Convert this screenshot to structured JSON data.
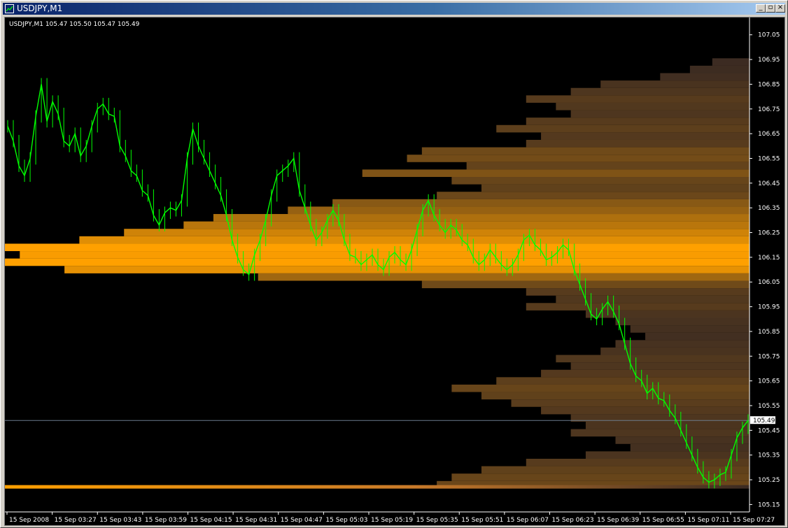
{
  "window": {
    "title": "USDJPY,M1",
    "buttons": [
      "minimize",
      "maximize",
      "close"
    ]
  },
  "chart": {
    "info_line": "USDJPY,M1  105.47 105.50 105.47 105.49",
    "current_price_label": "105.49",
    "colors": {
      "background": "#000000",
      "candles": "#00ff00",
      "profile_peak": "#ffa000",
      "profile_low": "#3a2a22",
      "axis_text": "#ffffff",
      "current_price_line": "#6b7b8c"
    }
  },
  "chart_data": {
    "type": "line",
    "title": "",
    "ylim": [
      105.12,
      107.12
    ],
    "price_ticks": [
      "107.05",
      "106.95",
      "106.85",
      "106.75",
      "106.65",
      "106.55",
      "106.45",
      "106.35",
      "106.25",
      "106.15",
      "106.05",
      "105.95",
      "105.85",
      "105.75",
      "105.65",
      "105.55",
      "105.45",
      "105.35",
      "105.25",
      "105.15"
    ],
    "time_ticks": [
      "15 Sep 2008",
      "15 Sep 03:27",
      "15 Sep 03:43",
      "15 Sep 03:59",
      "15 Sep 04:15",
      "15 Sep 04:31",
      "15 Sep 04:47",
      "15 Sep 05:03",
      "15 Sep 05:19",
      "15 Sep 05:35",
      "15 Sep 05:51",
      "15 Sep 06:07",
      "15 Sep 06:23",
      "15 Sep 06:39",
      "15 Sep 06:55",
      "15 Sep 07:11",
      "15 Sep 07:27"
    ],
    "series": [
      {
        "type": "candles-close",
        "values": [
          106.68,
          106.62,
          106.52,
          106.48,
          106.55,
          106.72,
          106.85,
          106.7,
          106.78,
          106.73,
          106.62,
          106.6,
          106.65,
          106.56,
          106.6,
          106.68,
          106.75,
          106.77,
          106.73,
          106.72,
          106.6,
          106.56,
          106.5,
          106.48,
          106.42,
          106.4,
          106.32,
          106.28,
          106.33,
          106.35,
          106.34,
          106.38,
          106.55,
          106.67,
          106.6,
          106.55,
          106.5,
          106.45,
          106.4,
          106.32,
          106.22,
          106.15,
          106.1,
          106.08,
          106.16,
          106.22,
          106.3,
          106.4,
          106.48,
          106.5,
          106.52,
          106.55,
          106.42,
          106.35,
          106.28,
          106.22,
          106.25,
          106.3,
          106.34,
          106.3,
          106.22,
          106.16,
          106.15,
          106.12,
          106.14,
          106.16,
          106.12,
          106.1,
          106.15,
          106.17,
          106.14,
          106.12,
          106.18,
          106.26,
          106.34,
          106.38,
          106.32,
          106.28,
          106.25,
          106.28,
          106.26,
          106.22,
          106.2,
          106.15,
          106.12,
          106.14,
          106.18,
          106.15,
          106.12,
          106.1,
          106.12,
          106.16,
          106.22,
          106.24,
          106.2,
          106.18,
          106.14,
          106.15,
          106.17,
          106.2,
          106.18,
          106.1,
          106.04,
          105.98,
          105.92,
          105.9,
          105.94,
          105.97,
          105.93,
          105.88,
          105.8,
          105.72,
          105.67,
          105.65,
          105.6,
          105.62,
          105.58,
          105.57,
          105.53,
          105.5,
          105.45,
          105.4,
          105.35,
          105.3,
          105.26,
          105.24,
          105.25,
          105.27,
          105.28,
          105.35,
          105.42,
          105.46,
          105.49
        ]
      }
    ],
    "profile": {
      "levels": [
        106.94,
        106.91,
        106.88,
        106.85,
        106.82,
        106.79,
        106.76,
        106.73,
        106.7,
        106.67,
        106.64,
        106.61,
        106.58,
        106.55,
        106.52,
        106.49,
        106.46,
        106.43,
        106.4,
        106.37,
        106.34,
        106.31,
        106.28,
        106.25,
        106.22,
        106.19,
        106.16,
        106.13,
        106.1,
        106.07,
        106.04,
        106.01,
        105.98,
        105.95,
        105.92,
        105.89,
        105.86,
        105.83,
        105.8,
        105.77,
        105.74,
        105.71,
        105.68,
        105.65,
        105.62,
        105.59,
        105.56,
        105.53,
        105.5,
        105.47,
        105.44,
        105.41,
        105.38,
        105.35,
        105.32,
        105.29,
        105.26,
        105.23
      ],
      "volumes": [
        5,
        8,
        12,
        20,
        24,
        30,
        26,
        24,
        30,
        34,
        28,
        30,
        44,
        46,
        38,
        52,
        40,
        36,
        42,
        56,
        62,
        72,
        76,
        84,
        90,
        100,
        98,
        100,
        92,
        66,
        44,
        30,
        26,
        30,
        22,
        18,
        16,
        14,
        18,
        20,
        26,
        24,
        28,
        34,
        40,
        36,
        32,
        28,
        24,
        22,
        24,
        18,
        16,
        22,
        30,
        36,
        40,
        42
      ]
    }
  }
}
